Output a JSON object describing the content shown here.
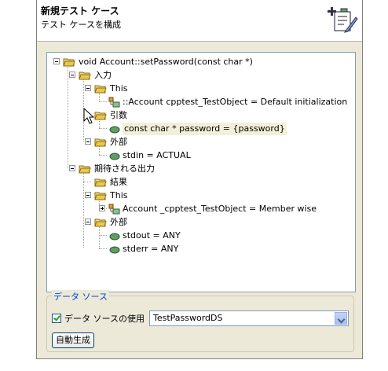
{
  "header": {
    "title": "新規テスト ケース",
    "description": "テスト ケースを構成"
  },
  "tree": {
    "root": "void Account::setPassword(const char *)",
    "input": "入力",
    "this1": "This",
    "this1_child": "::Account cpptest_TestObject = Default initialization",
    "args": "引数",
    "args_child": "const char * password = {password}",
    "external1": "外部",
    "external1_child": "stdin = ACTUAL",
    "expected": "期待される出力",
    "result": "結果",
    "this2": "This",
    "this2_child": "Account _cpptest_TestObject = Member wise",
    "external2": "外部",
    "stdout": "stdout = ANY",
    "stderr": "stderr = ANY"
  },
  "datasource": {
    "group_title": "データ ソース",
    "use_label": "データ ソースの使用",
    "selected": "TestPasswordDS",
    "autogen": "自動生成"
  },
  "colors": {
    "folder": "#e9c84b",
    "accent": "#0046d5",
    "object": "#5f9f5f"
  }
}
